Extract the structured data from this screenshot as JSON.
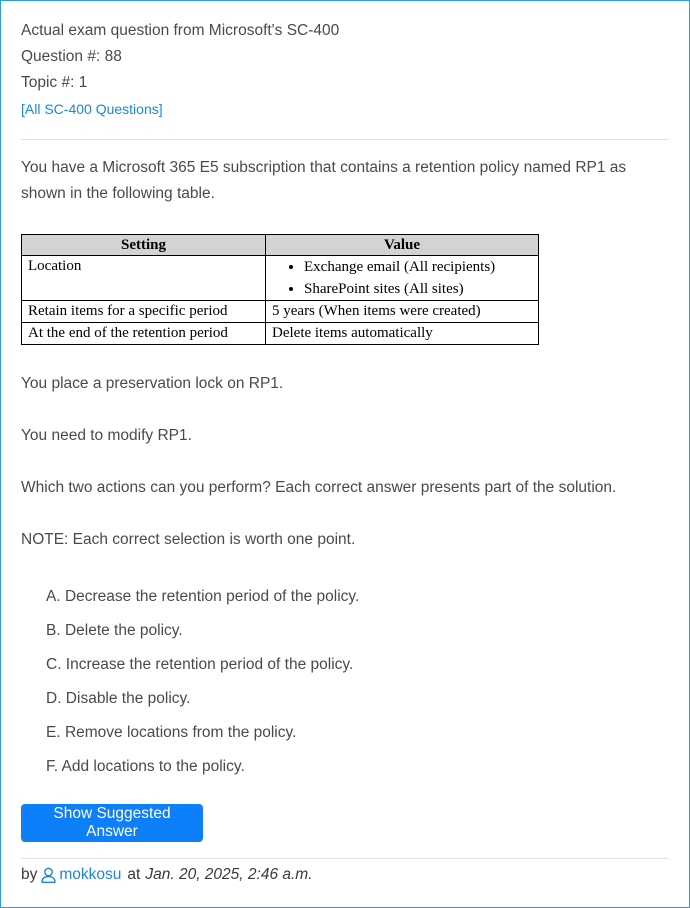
{
  "header": {
    "exam_line": "Actual exam question from Microsoft's SC-400",
    "question_number": "Question #: 88",
    "topic": "Topic #: 1",
    "all_questions_link": "[All SC-400 Questions]"
  },
  "question": {
    "intro": "You have a Microsoft 365 E5 subscription that contains a retention policy named RP1 as shown in the following table.",
    "table": {
      "headers": [
        "Setting",
        "Value"
      ],
      "rows": [
        {
          "setting": "Location",
          "values": [
            "Exchange email (All recipients)",
            "SharePoint sites (All sites)"
          ]
        },
        {
          "setting": "Retain items for a specific period",
          "value": "5 years (When items were created)"
        },
        {
          "setting": "At the end of the retention period",
          "value": "Delete items automatically"
        }
      ]
    },
    "paragraphs": [
      "You place a preservation lock on RP1.",
      "You need to modify RP1.",
      "Which two actions can you perform? Each correct answer presents part of the solution.",
      "NOTE: Each correct selection is worth one point."
    ],
    "choices": [
      "A. Decrease the retention period of the policy.",
      "B. Delete the policy.",
      "C. Increase the retention period of the policy.",
      "D. Disable the policy.",
      "E. Remove locations from the policy.",
      "F. Add locations to the policy."
    ]
  },
  "actions": {
    "show_answer_label": "Show Suggested Answer"
  },
  "byline": {
    "prefix": "by",
    "username": "mokkosu",
    "at": "at",
    "date": "Jan. 20, 2025, 2:46 a.m.",
    "user_icon": "user-icon"
  },
  "colors": {
    "link": "#1a88d4",
    "button": "#0d7ff9",
    "frame_border": "#2a9fd6",
    "table_header_bg": "#d4d2d2"
  }
}
